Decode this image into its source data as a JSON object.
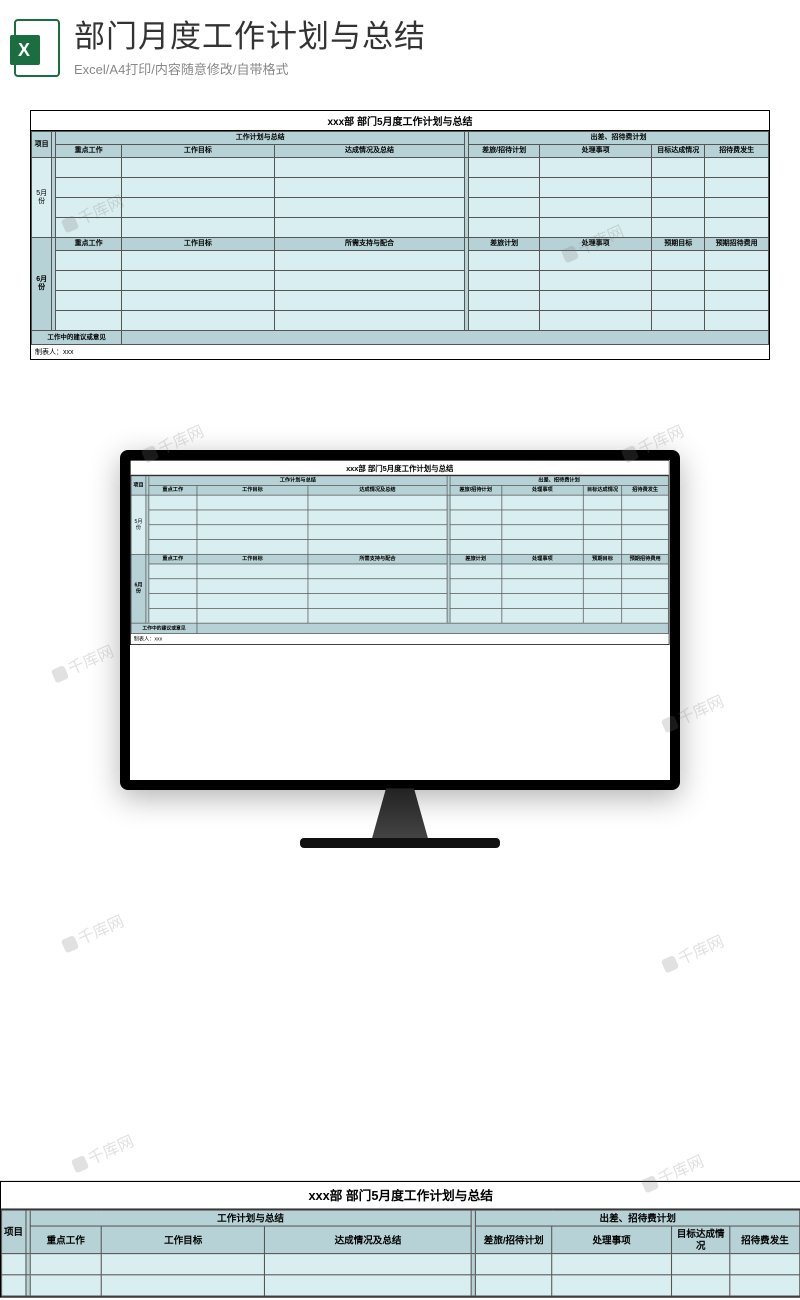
{
  "header": {
    "title": "部门月度工作计划与总结",
    "subtitle": "Excel/A4打印/内容随意修改/自带格式"
  },
  "sheet": {
    "title": "xxx部   部门5月度工作计划与总结",
    "col_project": "项目",
    "section_plan": "工作计划与总结",
    "section_expense": "出差、招待费计划",
    "month1": "5月份",
    "month2": "6月份",
    "row1": {
      "c1": "重点工作",
      "c2": "工作目标",
      "c3": "达成情况及总结",
      "c4": "差旅/招待计划",
      "c5": "处理事项",
      "c6": "目标达成情况",
      "c7": "招待费发生"
    },
    "row2": {
      "c1": "重点工作",
      "c2": "工作目标",
      "c3": "所需支持与配合",
      "c4": "差旅计划",
      "c5": "处理事项",
      "c6": "预期目标",
      "c7": "预期招待费用"
    },
    "footer_label": "工作中的建议或意见",
    "preparer": "制表人：xxx"
  },
  "watermark": "千库网"
}
